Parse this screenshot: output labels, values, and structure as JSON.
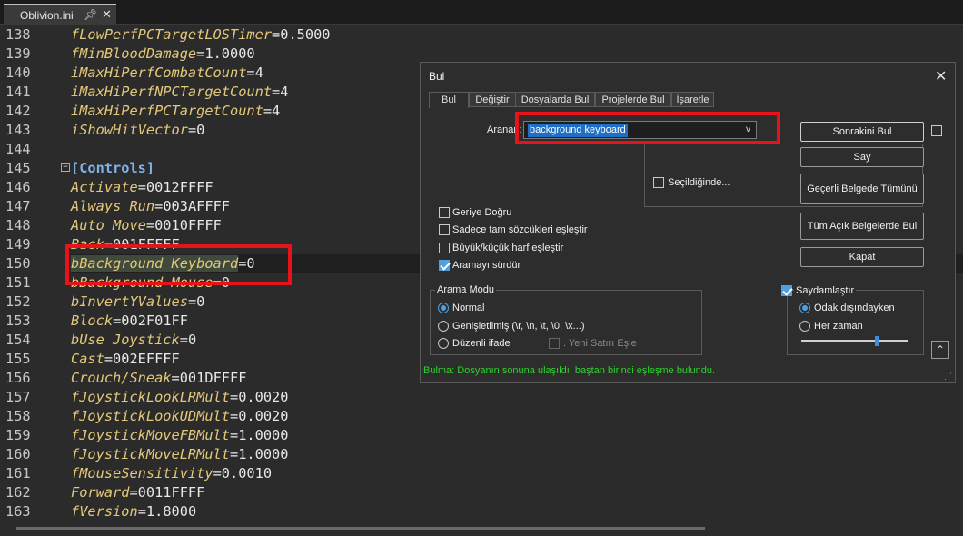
{
  "tab": {
    "title": "Oblivion.ini"
  },
  "editor": {
    "lines": [
      {
        "n": "138",
        "key": "fLowPerfPCTargetLOSTimer",
        "val": "=0.5000"
      },
      {
        "n": "139",
        "key": "fMinBloodDamage",
        "val": "=1.0000"
      },
      {
        "n": "140",
        "key": "iMaxHiPerfCombatCount",
        "val": "=4"
      },
      {
        "n": "141",
        "key": "iMaxHiPerfNPCTargetCount",
        "val": "=4"
      },
      {
        "n": "142",
        "key": "iMaxHiPerfPCTargetCount",
        "val": "=4"
      },
      {
        "n": "143",
        "key": "iShowHitVector",
        "val": "=0"
      },
      {
        "n": "144",
        "key": "",
        "val": ""
      },
      {
        "n": "145",
        "section": "[Controls]"
      },
      {
        "n": "146",
        "key": "Activate",
        "val": "=0012FFFF"
      },
      {
        "n": "147",
        "key": "Always Run",
        "val": "=003AFFFF"
      },
      {
        "n": "148",
        "key": "Auto Move",
        "val": "=0010FFFF"
      },
      {
        "n": "149",
        "key": "Back",
        "val": "=001FFFFF"
      },
      {
        "n": "150",
        "key": "bBackground Keyboard",
        "val": "=0"
      },
      {
        "n": "151",
        "key": "bBackground Mouse",
        "val": "=0"
      },
      {
        "n": "152",
        "key": "bInvertYValues",
        "val": "=0"
      },
      {
        "n": "153",
        "key": "Block",
        "val": "=002F01FF"
      },
      {
        "n": "154",
        "key": "bUse Joystick",
        "val": "=0"
      },
      {
        "n": "155",
        "key": "Cast",
        "val": "=002EFFFF"
      },
      {
        "n": "156",
        "key": "Crouch/Sneak",
        "val": "=001DFFFF"
      },
      {
        "n": "157",
        "key": "fJoystickLookLRMult",
        "val": "=0.0020"
      },
      {
        "n": "158",
        "key": "fJoystickLookUDMult",
        "val": "=0.0020"
      },
      {
        "n": "159",
        "key": "fJoystickMoveFBMult",
        "val": "=1.0000"
      },
      {
        "n": "160",
        "key": "fJoystickMoveLRMult",
        "val": "=1.0000"
      },
      {
        "n": "161",
        "key": "fMouseSensitivity",
        "val": "=0.0010"
      },
      {
        "n": "162",
        "key": "Forward",
        "val": "=0011FFFF"
      },
      {
        "n": "163",
        "key": "fVersion",
        "val": "=1.8000"
      }
    ]
  },
  "dialog": {
    "title": "Bul",
    "tabs": [
      "Bul",
      "Değiştir",
      "Dosyalarda Bul",
      "Projelerde Bul",
      "İşaretle"
    ],
    "search_label": "Aranan:",
    "search_value": "background keyboard",
    "buttons": {
      "find_next": "Sonrakini Bul",
      "count": "Say",
      "find_all_current": "Geçerli Belgede Tümünü Bul",
      "find_all_open": "Tüm Açık Belgelerde Bul",
      "close": "Kapat"
    },
    "in_selection": "Seçildiğinde...",
    "options": [
      {
        "label": "Geriye Doğru",
        "checked": false
      },
      {
        "label": "Sadece tam sözcükleri eşleştir",
        "checked": false
      },
      {
        "label": "Büyük/küçük harf eşleştir",
        "checked": false
      },
      {
        "label": "Aramayı sürdür",
        "checked": true
      }
    ],
    "search_mode": {
      "title": "Arama Modu",
      "normal": "Normal",
      "extended": "Genişletilmiş (\\r, \\n, \\t, \\0, \\x...)",
      "regex": "Düzenli ifade",
      "newline": ". Yeni Satırı Eşle",
      "selected": "Normal"
    },
    "transparency": {
      "title": "Saydamlaştır",
      "checked": true,
      "on_lose_focus": "Odak dışındayken",
      "always": "Her zaman",
      "selected": "Odak dışındayken",
      "level": 0.7
    },
    "status": "Bulma: Dosyanın sonuna ulaşıldı, baştan birinci eşleşme bulundu."
  },
  "colors": {
    "status": "#2fd12f",
    "highlight": "#e8121a",
    "accent": "#4ea0e0"
  }
}
